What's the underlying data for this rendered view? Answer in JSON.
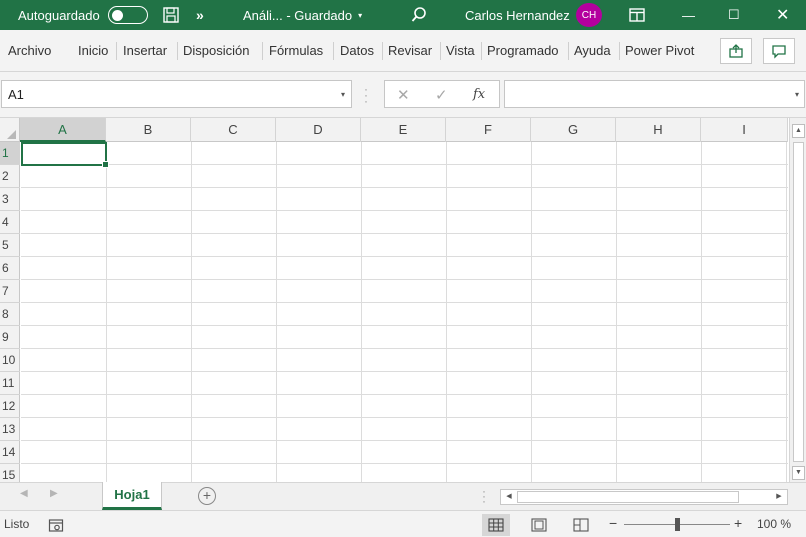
{
  "titlebar": {
    "autosave_label": "Autoguardado",
    "more_label": "»",
    "doc_title": "Análi... - Guardado",
    "caret": "▾",
    "user_name": "Carlos Hernandez",
    "avatar_initials": "CH",
    "min_glyph": "—",
    "max_glyph": "☐",
    "close_glyph": "✕"
  },
  "ribbon": {
    "tabs": [
      "Archivo",
      "Inicio",
      "Insertar",
      "Disposición",
      "Fórmulas",
      "Datos",
      "Revisar",
      "Vista",
      "Programado",
      "Ayuda",
      "Power Pivot"
    ]
  },
  "formula_bar": {
    "name_box": "A1",
    "cancel_glyph": "✕",
    "enter_glyph": "✓",
    "fx_label": "fx",
    "formula": "",
    "dropdown_glyph": "▾"
  },
  "grid": {
    "columns": [
      "A",
      "B",
      "C",
      "D",
      "E",
      "F",
      "G",
      "H",
      "I"
    ],
    "rows": [
      "1",
      "2",
      "3",
      "4",
      "5",
      "6",
      "7",
      "8",
      "9",
      "10",
      "11",
      "12",
      "13",
      "14",
      "15"
    ],
    "active_cell": "A1"
  },
  "sheets": {
    "tabs": [
      "Hoja1"
    ],
    "add_glyph": "+"
  },
  "statusbar": {
    "status": "Listo",
    "zoom_minus": "−",
    "zoom_plus": "+",
    "zoom": "100 %",
    "zoom_fraction": 0.5
  },
  "colors": {
    "accent": "#217346",
    "avatar": "#b4009e"
  }
}
